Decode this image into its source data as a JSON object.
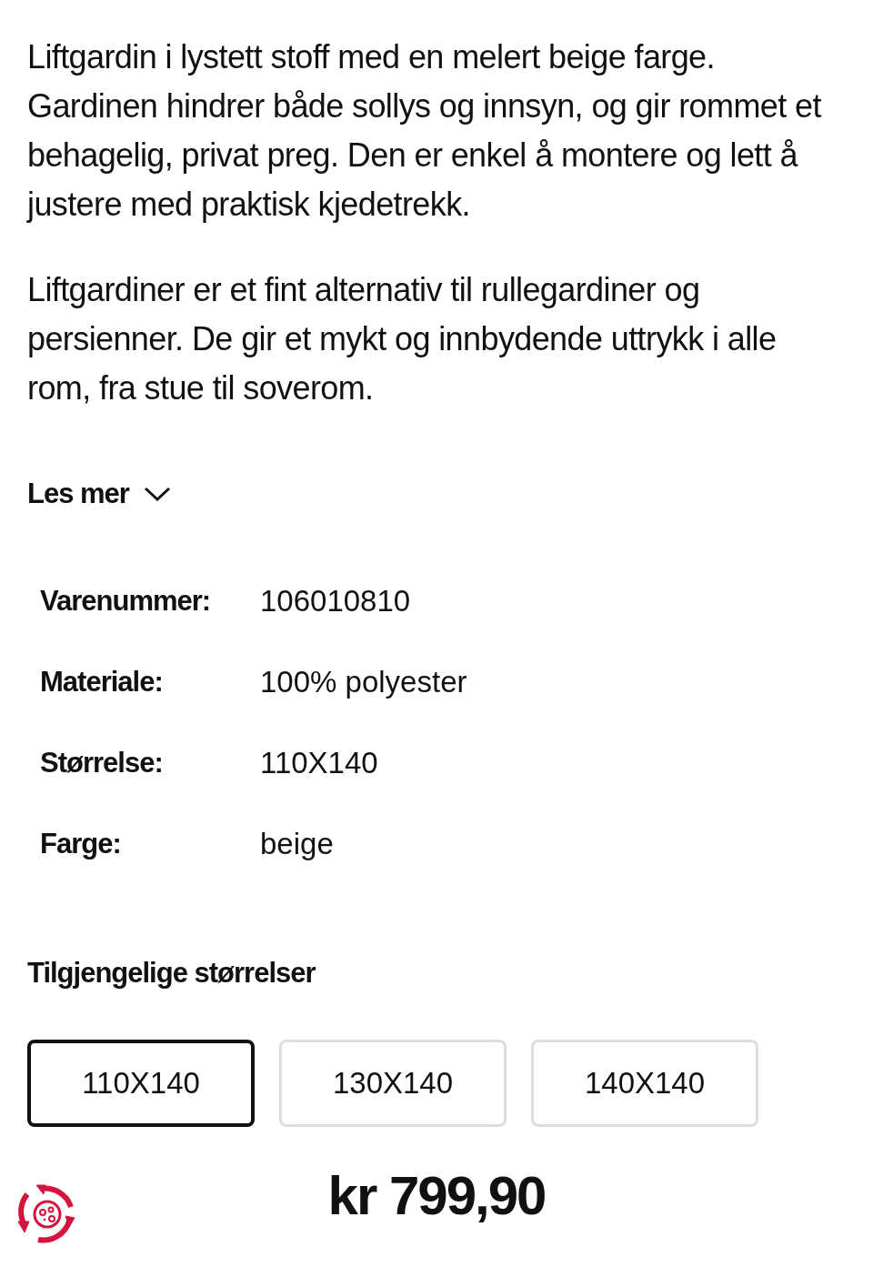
{
  "description": [
    "Liftgardin i lystett stoff med en melert beige farge. Gardinen hindrer både sollys og innsyn, og gir rommet et behagelig, privat preg. Den er enkel å montere og lett å justere med praktisk kjedetrekk.",
    "Liftgardiner er et fint alternativ til rullegardiner og persienner. De gir et mykt og innbydende uttrykk i alle rom, fra stue til soverom."
  ],
  "read_more": {
    "label": "Les mer",
    "expanded": false
  },
  "specs": [
    {
      "label": "Varenummer:",
      "value": "106010810"
    },
    {
      "label": "Materiale:",
      "value": "100% polyester"
    },
    {
      "label": "Størrelse:",
      "value": "110X140"
    },
    {
      "label": "Farge:",
      "value": "beige"
    }
  ],
  "sizes": {
    "title": "Tilgjengelige størrelser",
    "options": [
      {
        "label": "110X140",
        "selected": true
      },
      {
        "label": "130X140",
        "selected": false
      },
      {
        "label": "140X140",
        "selected": false
      }
    ]
  },
  "price": "kr 799,90"
}
